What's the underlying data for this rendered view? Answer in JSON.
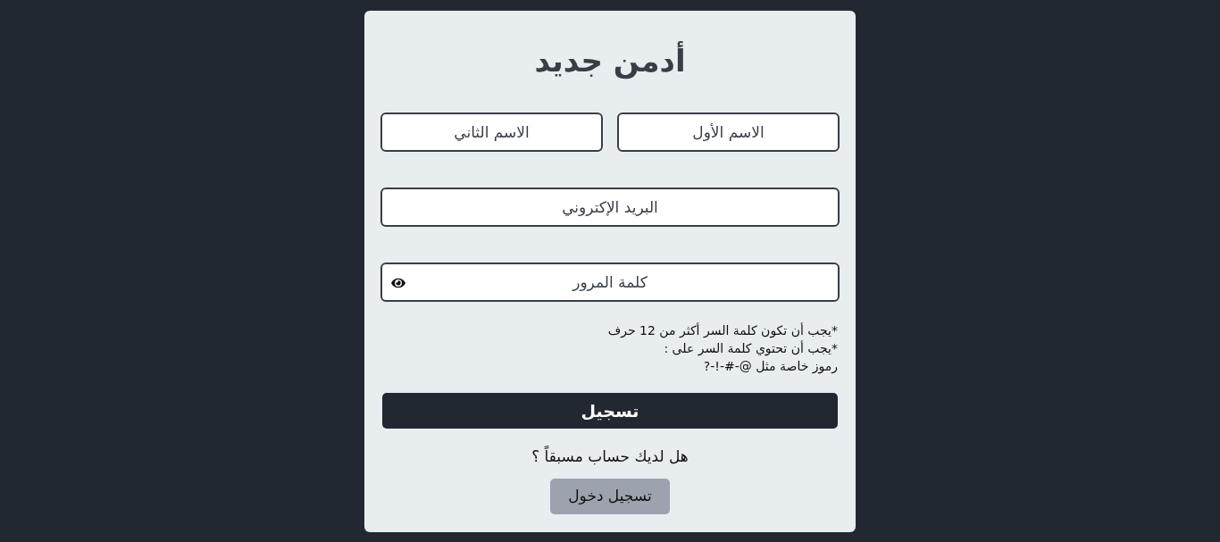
{
  "title": "أدمن جديد",
  "name_fields": [
    {
      "placeholder": "الاسم الأول"
    },
    {
      "placeholder": "الاسم الثاني"
    }
  ],
  "email_field": {
    "placeholder": "البريد الإكتروني"
  },
  "password_field": {
    "placeholder": "كلمة المرور"
  },
  "password_hints": [
    "*يجب أن تكون كلمة السر أكثر من 12 حرف",
    "*يجب أن تحتوي كلمة السر على :",
    "رموز خاصة مثل @-#-!-?"
  ],
  "submit_button": "تسجيل",
  "login_prompt": "هل لديك حساب مسبقاً ؟",
  "login_button": "تسجيل دخول"
}
